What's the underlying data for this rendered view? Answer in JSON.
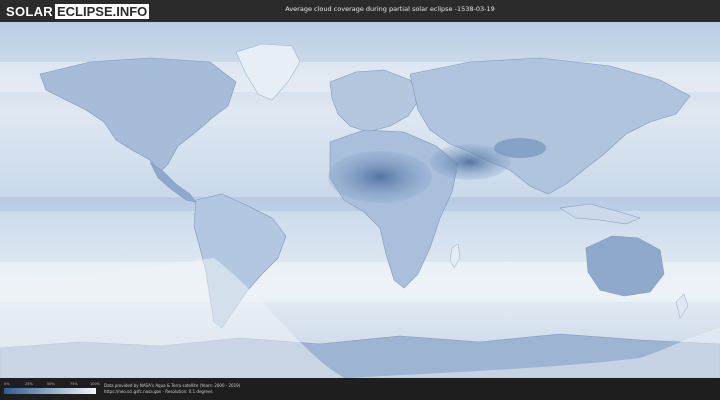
{
  "header": {
    "logo_part1": "SOLAR",
    "logo_part2": "ECLIPSE.INFO",
    "title": "Average cloud coverage during partial solar eclipse -1538-03-19"
  },
  "legend": {
    "ticks": [
      "0%",
      "25%",
      "50%",
      "75%",
      "100%"
    ],
    "colors": {
      "low": "#2f5b95",
      "high": "#f4f8fb"
    }
  },
  "credits": {
    "line1": "Data provided by NASA's Aqua & Terra satellite (Years: 2000 - 2019)",
    "line2": "https://neo.sci.gsfc.nasa.gov - Resolution: 0.1 degrees"
  },
  "map": {
    "ocean_color": "#cfdcea",
    "land_color": "#9fb6d3",
    "dry_region_color": "#5f7fae",
    "eclipse_zone_color": "#e9eef3"
  }
}
